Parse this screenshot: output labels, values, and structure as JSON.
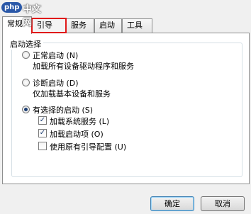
{
  "watermark": {
    "brand": "php",
    "site": "中文网"
  },
  "tabs": [
    {
      "label": "常规"
    },
    {
      "label": "引导"
    },
    {
      "label": "服务"
    },
    {
      "label": "启动"
    },
    {
      "label": "工具"
    }
  ],
  "group": {
    "title": "启动选择"
  },
  "options": {
    "normal": {
      "label": "正常启动 (N)",
      "desc": "加载所有设备驱动程序和服务"
    },
    "diagnostic": {
      "label": "诊断启动 (D)",
      "desc": "仅加载基本设备和服务"
    },
    "selective": {
      "label": "有选择的启动 (S)",
      "items": [
        {
          "label": "加载系统服务 (L)",
          "checked": true
        },
        {
          "label": "加载启动项 (O)",
          "checked": true
        },
        {
          "label": "使用原有引导配置 (U)",
          "checked": false
        }
      ]
    }
  },
  "buttons": {
    "ok": "确定",
    "cancel": "取消"
  }
}
